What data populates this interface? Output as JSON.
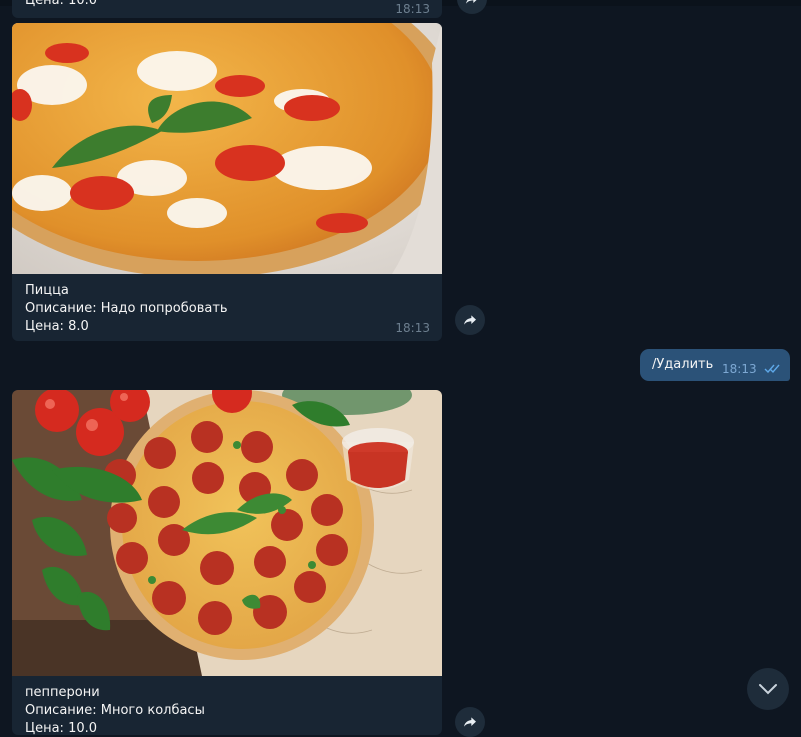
{
  "messages": [
    {
      "partial_caption": "Цена: 10.0",
      "time": "18:13"
    },
    {
      "name": "Пицца",
      "description": "Описание: Надо попробовать",
      "price": "Цена: 8.0",
      "time": "18:13"
    },
    {
      "text": "/Удалить",
      "time": "18:13",
      "status": "double-check-read"
    },
    {
      "name": "пепперони",
      "description": "Описание: Много колбасы",
      "price": "Цена: 10.0"
    }
  ],
  "icons": {
    "share": "share-arrow-icon",
    "scroll_down": "chevron-down-icon",
    "read_status": "double-check-icon"
  },
  "colors": {
    "background": "#0e1621",
    "incoming_bubble": "#182533",
    "outgoing_bubble": "#2b5278",
    "timestamp": "#6d7f8f",
    "check_marks": "#5ea8e8"
  }
}
